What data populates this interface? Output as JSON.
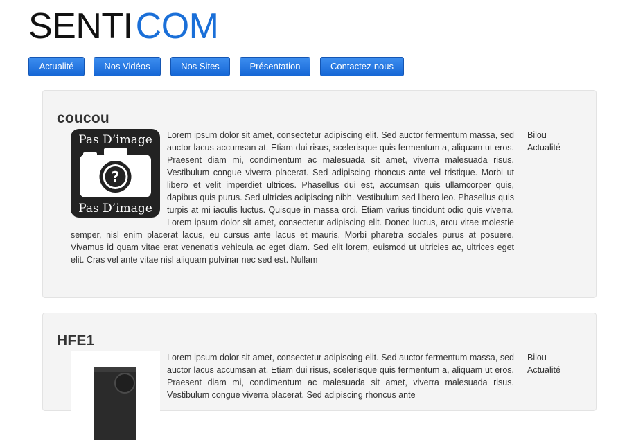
{
  "header": {
    "logo_part1": "SENTI",
    "logo_part2": "COM"
  },
  "nav": {
    "items": [
      {
        "label": "Actualité"
      },
      {
        "label": "Nos Vidéos"
      },
      {
        "label": "Nos Sites"
      },
      {
        "label": "Présentation"
      },
      {
        "label": "Contactez-nous"
      }
    ]
  },
  "posts": [
    {
      "title": "coucou",
      "image_caption_top": "Pas D’image",
      "image_caption_bottom": "Pas D’image",
      "body": "Lorem ipsum dolor sit amet, consectetur adipiscing elit. Sed auctor fermentum massa, sed auctor lacus accumsan at. Etiam dui risus, scelerisque quis fermentum a, aliquam ut eros. Praesent diam mi, condimentum ac malesuada sit amet, viverra malesuada risus. Vestibulum congue viverra placerat. Sed adipiscing rhoncus ante vel tristique. Morbi ut libero et velit imperdiet ultrices. Phasellus dui est, accumsan quis ullamcorper quis, dapibus quis purus. Sed ultricies adipiscing nibh. Vestibulum sed libero leo. Phasellus quis turpis at mi iaculis luctus. Quisque in massa orci. Etiam varius tincidunt odio quis viverra. Lorem ipsum dolor sit amet, consectetur adipiscing elit. Donec luctus, arcu vitae molestie semper, nisl enim placerat lacus, eu cursus ante lacus et mauris. Morbi pharetra sodales purus at posuere. Vivamus id quam vitae erat venenatis vehicula ac eget diam. Sed elit lorem, euismod ut ultricies ac, ultrices eget elit. Cras vel ante vitae nisl aliquam pulvinar nec sed est. Nullam",
      "author": "Bilou",
      "category": "Actualité"
    },
    {
      "title": "HFE1",
      "body": "Lorem ipsum dolor sit amet, consectetur adipiscing elit. Sed auctor fermentum massa, sed auctor lacus accumsan at. Etiam dui risus, scelerisque quis fermentum a, aliquam ut eros. Praesent diam mi, condimentum ac malesuada sit amet, viverra malesuada risus. Vestibulum congue viverra placerat. Sed adipiscing rhoncus ante",
      "author": "Bilou",
      "category": "Actualité"
    }
  ],
  "colors": {
    "brand_blue": "#1a6fd8",
    "nav_button": "#1667d6",
    "post_background": "#f4f4f4"
  }
}
